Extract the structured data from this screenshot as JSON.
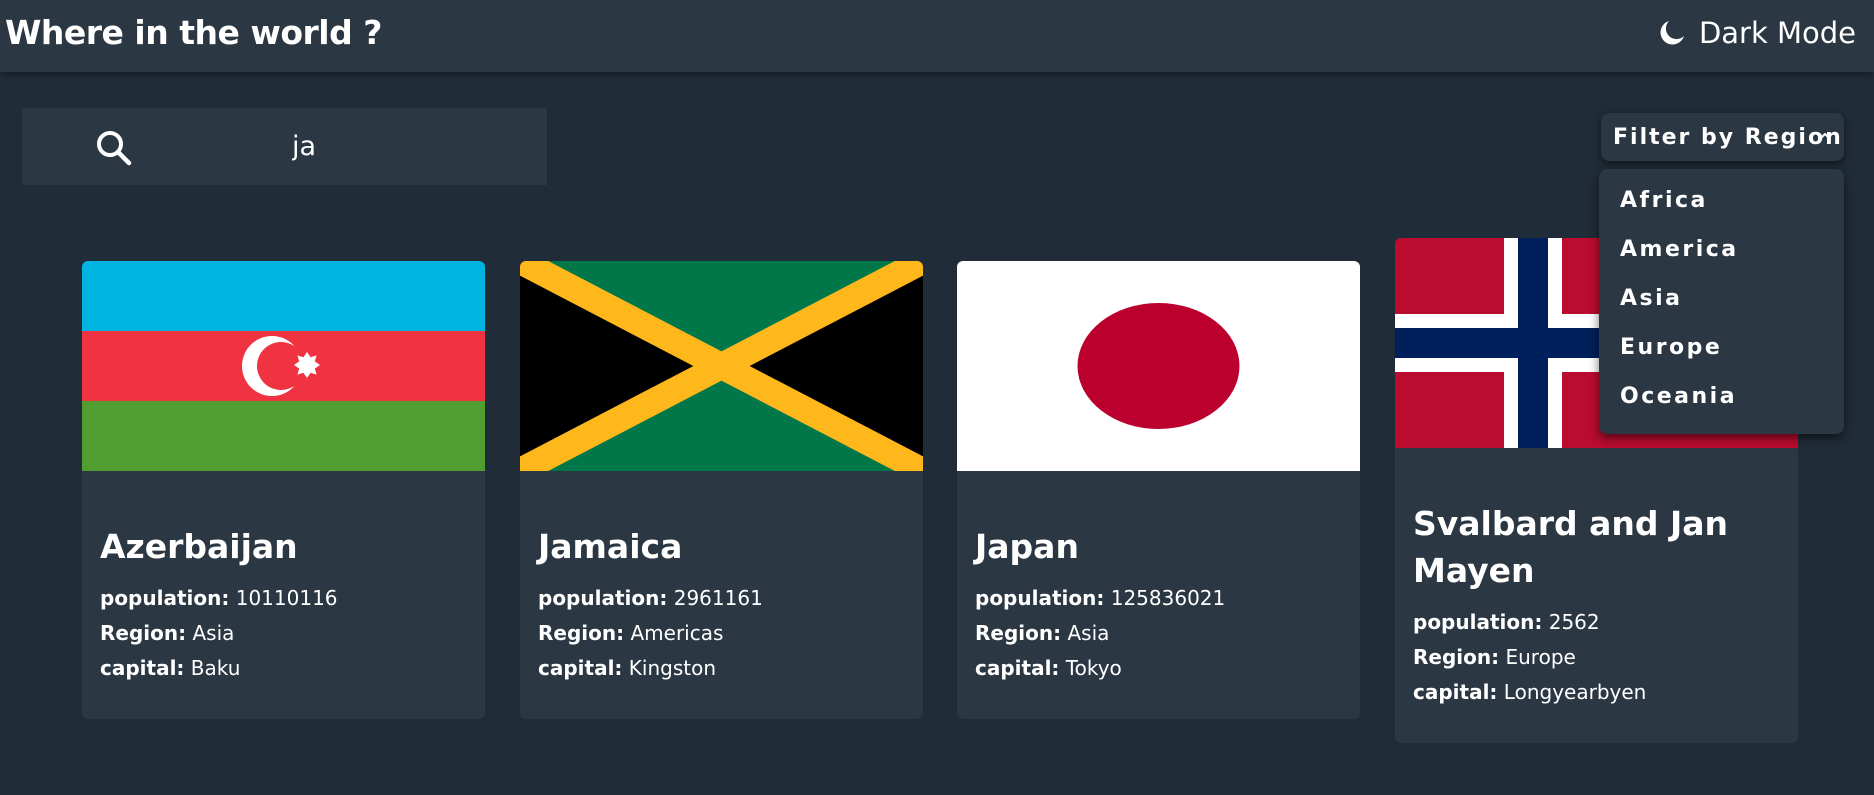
{
  "header": {
    "title": "Where in the world ?",
    "theme_label": "Dark Mode"
  },
  "search": {
    "value": "ja",
    "icon": "search-icon"
  },
  "filter": {
    "label": "Filter by Region",
    "options": [
      "Africa",
      "America",
      "Asia",
      "Europe",
      "Oceania"
    ]
  },
  "labels": {
    "population": "population:",
    "region": "Region:",
    "capital": "capital:"
  },
  "countries": [
    {
      "name": "Azerbaijan",
      "population": "10110116",
      "region": "Asia",
      "capital": "Baku",
      "flag": "azerbaijan-flag"
    },
    {
      "name": "Jamaica",
      "population": "2961161",
      "region": "Americas",
      "capital": "Kingston",
      "flag": "jamaica-flag"
    },
    {
      "name": "Japan",
      "population": "125836021",
      "region": "Asia",
      "capital": "Tokyo",
      "flag": "japan-flag"
    },
    {
      "name": "Svalbard and Jan Mayen",
      "population": "2562",
      "region": "Europe",
      "capital": "Longyearbyen",
      "flag": "norway-flag"
    }
  ],
  "colors": {
    "background": "#202c37",
    "surface": "#2b3743",
    "text": "#ffffff"
  }
}
